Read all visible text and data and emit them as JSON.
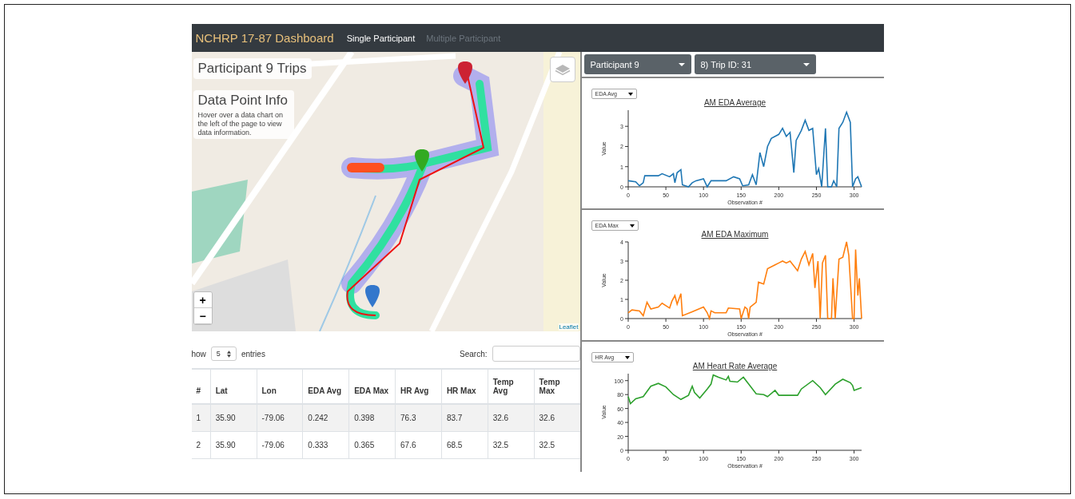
{
  "navbar": {
    "brand": "NCHRP 17-87 Dashboard",
    "links": [
      {
        "label": "Single Participant",
        "selected": true
      },
      {
        "label": "Multiple Participant",
        "selected": false
      }
    ]
  },
  "map": {
    "kind": "picture",
    "title": "Participant 9 Trips",
    "info": {
      "heading": "Data Point Info",
      "text": "Hover over a data chart on the left of the page to view data information."
    },
    "zoom_in": "+",
    "zoom_out": "−",
    "attribution": "Leaflet"
  },
  "table_controls": {
    "length_before": "how",
    "length_value": "5",
    "length_after": "entries",
    "search_label": "Search:"
  },
  "table": {
    "columns": [
      "#",
      "Lat",
      "Lon",
      "EDA Avg",
      "EDA Max",
      "HR Avg",
      "HR Max",
      "Temp Avg",
      "Temp Max"
    ],
    "rows": [
      [
        "1",
        "35.90",
        "-79.06",
        "0.242",
        "0.398",
        "76.3",
        "83.7",
        "32.6",
        "32.6"
      ],
      [
        "2",
        "35.90",
        "-79.06",
        "0.333",
        "0.365",
        "67.6",
        "68.5",
        "32.5",
        "32.5"
      ]
    ]
  },
  "selectors": [
    {
      "value": "Participant 9"
    },
    {
      "value": "8) Trip ID: 31"
    }
  ],
  "panels": [
    {
      "select": "EDA Avg",
      "chart_data": {
        "type": "line",
        "title": "AM EDA Average",
        "xlabel": "Observation #",
        "ylabel": "Value",
        "x": [
          0,
          10,
          15,
          20,
          22,
          40,
          45,
          55,
          60,
          62,
          65,
          70,
          72,
          80,
          85,
          90,
          100,
          105,
          110,
          130,
          140,
          148,
          152,
          160,
          165,
          170,
          175,
          180,
          185,
          190,
          200,
          205,
          210,
          215,
          220,
          223,
          230,
          235,
          240,
          245,
          250,
          253,
          257,
          262,
          265,
          270,
          273,
          277,
          280,
          285,
          290,
          295,
          298,
          302,
          305,
          310
        ],
        "series": [
          {
            "color": "#1f77b4",
            "values": [
              0.3,
              0.25,
              0.05,
              0.2,
              0.55,
              0.55,
              0.65,
              0.5,
              0.65,
              0.2,
              0.7,
              0.85,
              0.1,
              0,
              0.2,
              0.3,
              0.4,
              0,
              0.3,
              0.3,
              0.5,
              0.4,
              0.05,
              0.1,
              0.6,
              0.1,
              1.7,
              1,
              2,
              2.4,
              2.6,
              2.9,
              2.5,
              2.7,
              0.7,
              2.3,
              2.8,
              3.3,
              2.8,
              2.9,
              0.6,
              0.9,
              0,
              2.9,
              0,
              0,
              0.3,
              0,
              2.9,
              3.2,
              3.7,
              3.2,
              0,
              0.4,
              0.5,
              0
            ]
          }
        ],
        "xlim": [
          0,
          310
        ],
        "ylim": [
          0,
          3.8
        ],
        "xticks": [
          0,
          50,
          100,
          150,
          200,
          250,
          300
        ],
        "yticks": [
          0,
          1,
          2,
          3
        ]
      }
    },
    {
      "select": "EDA Max",
      "chart_data": {
        "type": "line",
        "title": "AM EDA Maximum",
        "xlabel": "Observation #",
        "ylabel": "Value",
        "x": [
          0,
          5,
          15,
          20,
          25,
          30,
          40,
          45,
          55,
          58,
          62,
          65,
          70,
          72,
          85,
          100,
          105,
          108,
          110,
          115,
          130,
          133,
          148,
          150,
          155,
          158,
          160,
          162,
          170,
          173,
          180,
          185,
          195,
          200,
          205,
          210,
          215,
          225,
          230,
          235,
          240,
          245,
          248,
          252,
          255,
          258,
          262,
          265,
          270,
          272,
          275,
          280,
          285,
          290,
          293,
          298,
          300,
          302,
          305,
          307,
          310
        ],
        "series": [
          {
            "color": "#ff7f0e",
            "values": [
              0.3,
              0.45,
              0.4,
              0.15,
              0.85,
              0.5,
              0.6,
              0.8,
              0.55,
              0.9,
              1.2,
              0.75,
              1.3,
              0.15,
              0.35,
              0.6,
              0.3,
              0,
              0.4,
              0.3,
              0.3,
              0.55,
              0.5,
              0,
              0.6,
              0.5,
              0,
              0.6,
              0.85,
              1.9,
              1.8,
              2.6,
              2.8,
              2.9,
              3,
              2.9,
              3,
              2.5,
              3.1,
              3.5,
              2.8,
              3.4,
              1.6,
              3,
              0,
              2.9,
              3.3,
              0,
              0,
              2.1,
              0,
              3.1,
              3.2,
              4,
              3.3,
              0,
              0,
              3.6,
              1.2,
              2.1,
              0
            ]
          }
        ],
        "xlim": [
          0,
          310
        ],
        "ylim": [
          0,
          4
        ],
        "xticks": [
          0,
          50,
          100,
          150,
          200,
          250,
          300
        ],
        "yticks": [
          0,
          1,
          2,
          3,
          4
        ]
      }
    },
    {
      "select": "HR Avg",
      "chart_data": {
        "type": "line",
        "title": "AM Heart Rate Average",
        "xlabel": "Observation #",
        "ylabel": "Value",
        "x": [
          0,
          3,
          10,
          20,
          30,
          40,
          50,
          60,
          70,
          80,
          85,
          88,
          95,
          105,
          110,
          113,
          120,
          130,
          133,
          135,
          145,
          153,
          160,
          170,
          180,
          185,
          195,
          200,
          225,
          230,
          245,
          255,
          262,
          275,
          285,
          295,
          298,
          300,
          305,
          310
        ],
        "series": [
          {
            "color": "#2ca02c",
            "values": [
              77,
              67,
              74,
              77,
              92,
              96,
              91,
              80,
              73,
              79,
              92,
              83,
              75,
              88,
              95,
              108,
              105,
              101,
              106,
              99,
              98,
              105,
              95,
              81,
              80,
              77,
              86,
              79,
              79,
              88,
              100,
              90,
              80,
              95,
              102,
              97,
              93,
              86,
              88,
              90
            ]
          }
        ],
        "xlim": [
          0,
          310
        ],
        "ylim": [
          0,
          110
        ],
        "xticks": [
          0,
          50,
          100,
          150,
          200,
          250,
          300
        ],
        "yticks": [
          0,
          20,
          40,
          60,
          80,
          100
        ]
      }
    }
  ]
}
